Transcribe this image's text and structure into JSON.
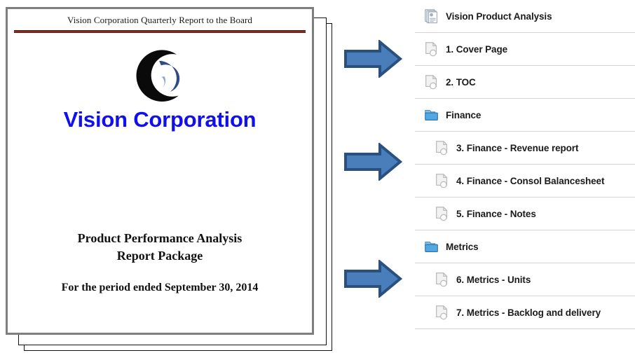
{
  "document": {
    "header_text": "Vision Corporation Quarterly Report to the Board",
    "brand": "Vision Corporation",
    "title_line_1": "Product Performance Analysis",
    "title_line_2": "Report Package",
    "period": "For the period ended September 30, 2014",
    "logo_icon": "vision-swirl-logo",
    "header_rule_color": "#8c2b22",
    "brand_color": "#1010ee",
    "page_border_color": "#7e7e7e"
  },
  "arrows": [
    {
      "icon": "right-block-arrow-icon",
      "fill": "#4a7ebb",
      "stroke": "#2a5080"
    },
    {
      "icon": "right-block-arrow-icon",
      "fill": "#4a7ebb",
      "stroke": "#2a5080"
    },
    {
      "icon": "right-block-arrow-icon",
      "fill": "#4a7ebb",
      "stroke": "#2a5080"
    }
  ],
  "tree": {
    "items": [
      {
        "label": "Vision Product Analysis",
        "icon": "report-stack-icon",
        "depth": 0
      },
      {
        "label": "1. Cover Page",
        "icon": "page-icon",
        "depth": 1
      },
      {
        "label": "2. TOC",
        "icon": "page-icon",
        "depth": 1
      },
      {
        "label": "Finance",
        "icon": "folder-icon",
        "depth": 1
      },
      {
        "label": "3. Finance - Revenue report",
        "icon": "page-icon",
        "depth": 2
      },
      {
        "label": "4. Finance - Consol Balancesheet",
        "icon": "page-icon",
        "depth": 2
      },
      {
        "label": "5. Finance - Notes",
        "icon": "page-icon",
        "depth": 2
      },
      {
        "label": "Metrics",
        "icon": "folder-icon",
        "depth": 1
      },
      {
        "label": "6. Metrics - Units",
        "icon": "page-icon",
        "depth": 2
      },
      {
        "label": "7. Metrics - Backlog and delivery",
        "icon": "page-icon",
        "depth": 2
      }
    ],
    "folder_color": "#4a9fe0",
    "rule_color": "#d4d4d4"
  }
}
